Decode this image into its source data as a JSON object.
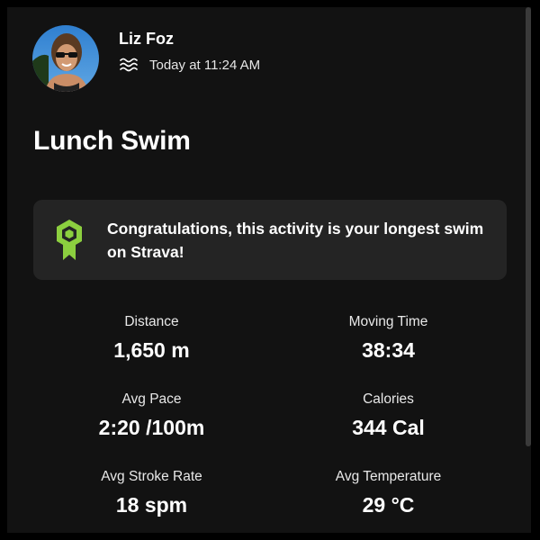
{
  "athlete": {
    "name": "Liz Foz",
    "sport_icon": "swim-waves-icon",
    "timestamp": "Today at 11:24 AM"
  },
  "activity": {
    "title": "Lunch Swim"
  },
  "achievement": {
    "icon": "achievement-badge-icon",
    "text": "Congratulations, this activity is your longest swim on Strava!",
    "badge_color": "#8ccf3f"
  },
  "stats": [
    {
      "label": "Distance",
      "value": "1,650 m"
    },
    {
      "label": "Moving Time",
      "value": "38:34"
    },
    {
      "label": "Avg Pace",
      "value": "2:20 /100m"
    },
    {
      "label": "Calories",
      "value": "344 Cal"
    },
    {
      "label": "Avg Stroke Rate",
      "value": "18 spm"
    },
    {
      "label": "Avg Temperature",
      "value": "29 °C"
    }
  ],
  "colors": {
    "background": "#121212",
    "card": "#242424",
    "text": "#ffffff"
  }
}
